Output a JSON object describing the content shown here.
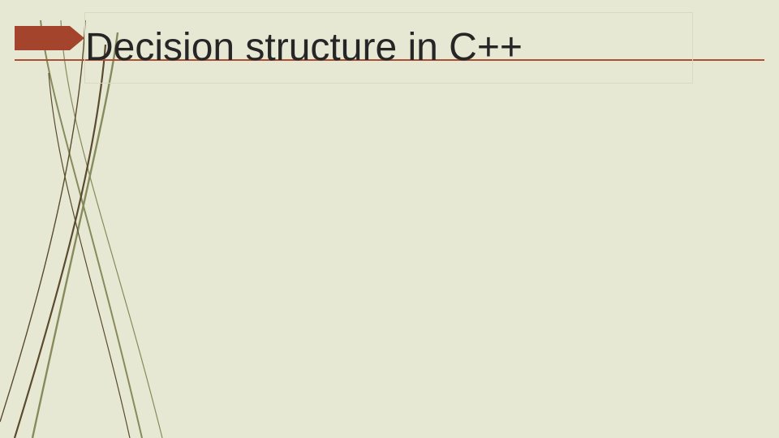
{
  "colors": {
    "background": "#e7e8d4",
    "accent": "#a5442c",
    "rule": "#ab4f33",
    "title": "#262626",
    "box_border": "#d9d9c0"
  },
  "title": "Decision structure in C++"
}
